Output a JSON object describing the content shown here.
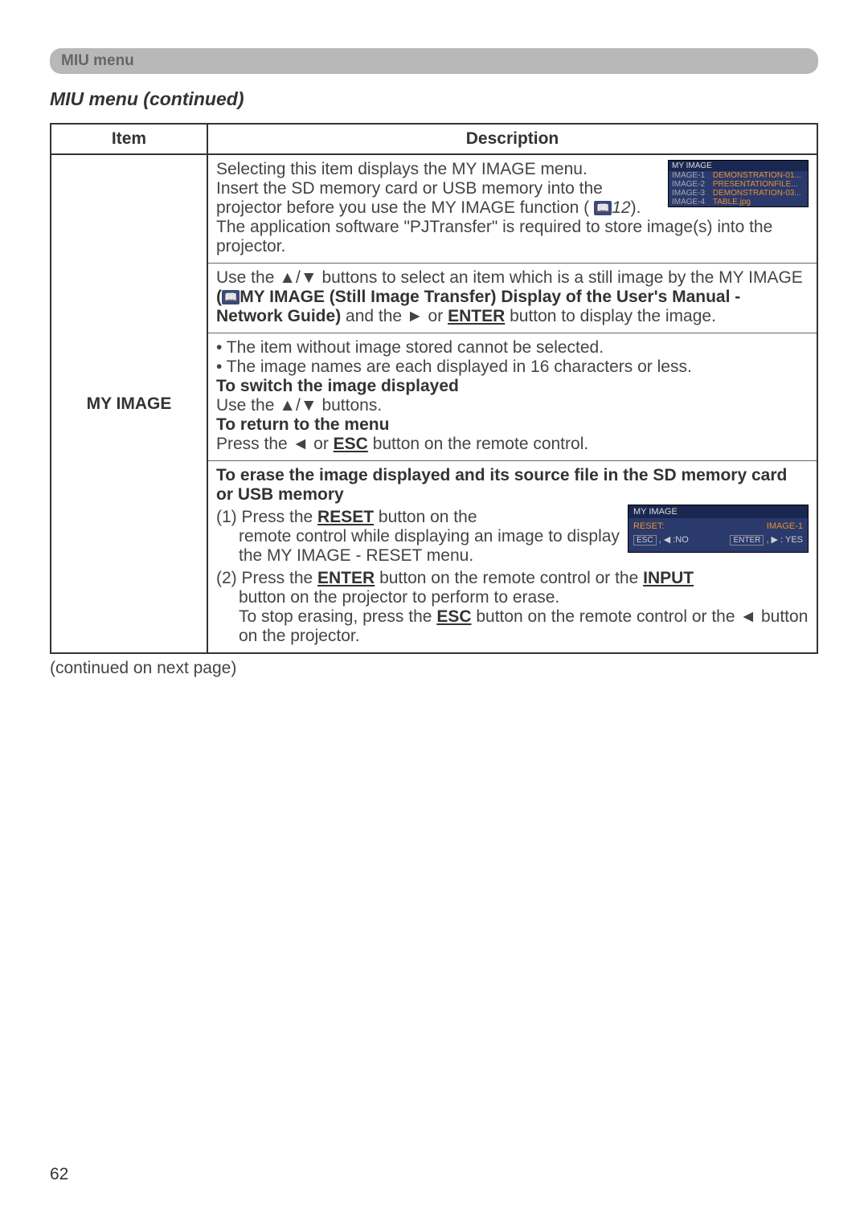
{
  "header": {
    "label": "MIU menu"
  },
  "section_title": "MIU menu (continued)",
  "table": {
    "headers": {
      "item": "Item",
      "description": "Description"
    },
    "item_name": "MY IMAGE",
    "p1": {
      "line1": "Selecting this item displays the MY IMAGE menu.",
      "line2a": "Insert the SD memory card or USB memory into the projector before you use the MY IMAGE function (",
      "line2ref": "12",
      "line2b": "). The application software \"PJTransfer\" is required to store image(s) into the projector."
    },
    "osd1": {
      "title": "MY IMAGE",
      "rows": [
        {
          "l": "IMAGE-1",
          "r": "DEMONSTRATION-01..."
        },
        {
          "l": "IMAGE-2",
          "r": "PRESENTATIONFILE..."
        },
        {
          "l": "IMAGE-3",
          "r": "DEMONSTRATION-03..."
        },
        {
          "l": "IMAGE-4",
          "r": "TABLE.jpg"
        }
      ]
    },
    "p2": {
      "a": "Use the ▲/▼ buttons to select an item which is a still image by the MY IMAGE ",
      "b_bold": "(📖MY IMAGE (Still Image Transfer) Display of the User's Manual - Network Guide)",
      "c": " and the ► or ",
      "enter": "ENTER",
      "d": " button to display the image."
    },
    "p3": {
      "bullet1": "• The item without image stored cannot be selected.",
      "bullet2": "• The image names are each displayed in 16 characters or less.",
      "switch_h": "To switch the image displayed",
      "switch_t": "Use the ▲/▼ buttons.",
      "return_h": "To return to the menu",
      "return_a": "Press the ◄ or ",
      "esc": "ESC",
      "return_b": " button on the remote control."
    },
    "p4": {
      "erase_h": "To erase the image displayed and its source file in the SD memory card or USB memory",
      "s1a": "(1) Press the ",
      "reset": "RESET",
      "s1b": " button on the remote control while displaying an image to display the MY IMAGE - RESET menu.",
      "s2a": "(2) Press the ",
      "enter": "ENTER",
      "s2b": " button on the remote control or the ",
      "input": "INPUT",
      "s2c": " button on the projector to perform to erase.",
      "s2d": "To stop erasing, press the ",
      "esc": "ESC",
      "s2e": " button on the remote control or the ◄ button on the projector."
    },
    "osd2": {
      "title": "MY IMAGE",
      "reset_l": "RESET:",
      "reset_r": "IMAGE-1",
      "no_l": "ESC , ◀ :NO",
      "yes_l": "ENTER , ▶ : YES"
    }
  },
  "continued": "(continued on next page)",
  "page_number": "62"
}
